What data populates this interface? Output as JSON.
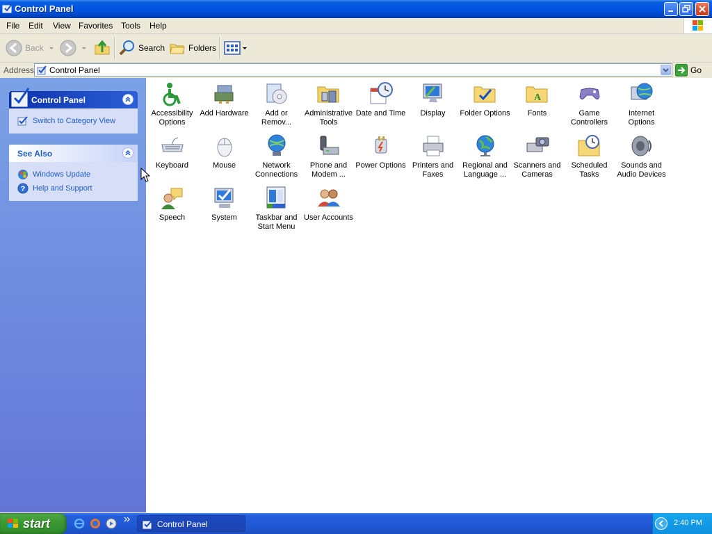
{
  "window": {
    "title": "Control Panel"
  },
  "menu": {
    "items": [
      "File",
      "Edit",
      "View",
      "Favorites",
      "Tools",
      "Help"
    ]
  },
  "toolbar": {
    "back_label": "Back",
    "search_label": "Search",
    "folders_label": "Folders"
  },
  "address": {
    "label": "Address",
    "value": "Control Panel",
    "go_label": "Go"
  },
  "sidebar": {
    "control_panel": {
      "title": "Control Panel",
      "link": "Switch to Category View"
    },
    "see_also": {
      "title": "See Also",
      "links": [
        "Windows Update",
        "Help and Support"
      ]
    }
  },
  "items": [
    {
      "label": "Accessibility Options"
    },
    {
      "label": "Add Hardware"
    },
    {
      "label": "Add or Remov..."
    },
    {
      "label": "Administrative Tools"
    },
    {
      "label": "Date and Time"
    },
    {
      "label": "Display"
    },
    {
      "label": "Folder Options"
    },
    {
      "label": "Fonts"
    },
    {
      "label": "Game Controllers"
    },
    {
      "label": "Internet Options"
    },
    {
      "label": "Keyboard"
    },
    {
      "label": "Mouse"
    },
    {
      "label": "Network Connections"
    },
    {
      "label": "Phone and Modem ..."
    },
    {
      "label": "Power Options"
    },
    {
      "label": "Printers and Faxes"
    },
    {
      "label": "Regional and Language ..."
    },
    {
      "label": "Scanners and Cameras"
    },
    {
      "label": "Scheduled Tasks"
    },
    {
      "label": "Sounds and Audio Devices"
    },
    {
      "label": "Speech"
    },
    {
      "label": "System"
    },
    {
      "label": "Taskbar and Start Menu"
    },
    {
      "label": "User Accounts"
    }
  ],
  "taskbar": {
    "start_label": "start",
    "task_label": "Control Panel",
    "clock": "2:40 PM"
  }
}
